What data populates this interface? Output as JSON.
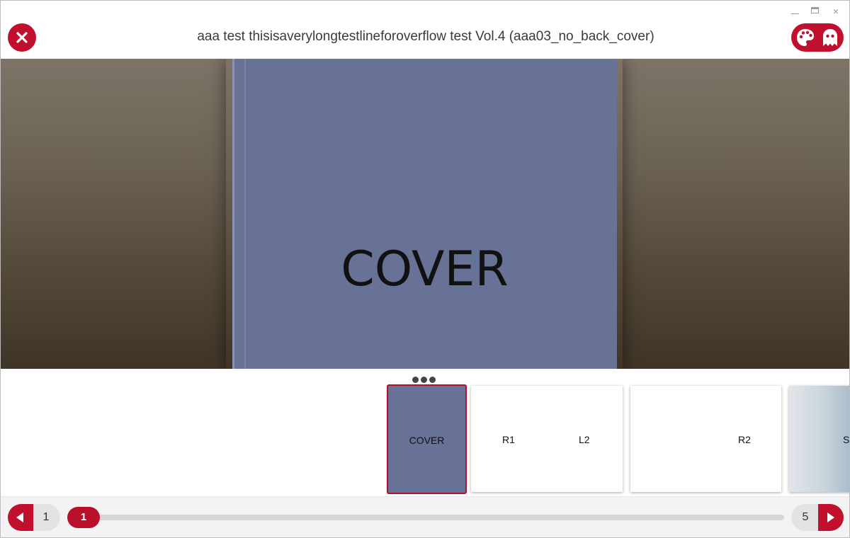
{
  "window": {
    "title": "aaa test thisisaverylongtestlineforoverflow test Vol.4 (aaa03_no_back_cover)",
    "accent_color": "#c0102e",
    "controls": [
      "minimize-icon",
      "maximize-icon",
      "close-icon"
    ],
    "close_glyph": "×"
  },
  "header": {
    "close_icon": "close-circle-icon",
    "tools_icons": [
      "palette-icon",
      "ghost-icon"
    ]
  },
  "viewer": {
    "page_text": "COVER",
    "page_color": "#687196"
  },
  "thumbnails": {
    "more_icon": "more-dots-icon",
    "items": [
      {
        "labels": [
          "COVER"
        ],
        "selected": true
      },
      {
        "labels": [
          "R1",
          "L2"
        ],
        "selected": false
      },
      {
        "labels": [
          "R2"
        ],
        "selected": false
      },
      {
        "labels": [
          "S"
        ],
        "selected": false
      }
    ]
  },
  "footer": {
    "prev_page": "1",
    "current_page": "1",
    "total_pages": "5",
    "progress_fraction": 0.0
  }
}
